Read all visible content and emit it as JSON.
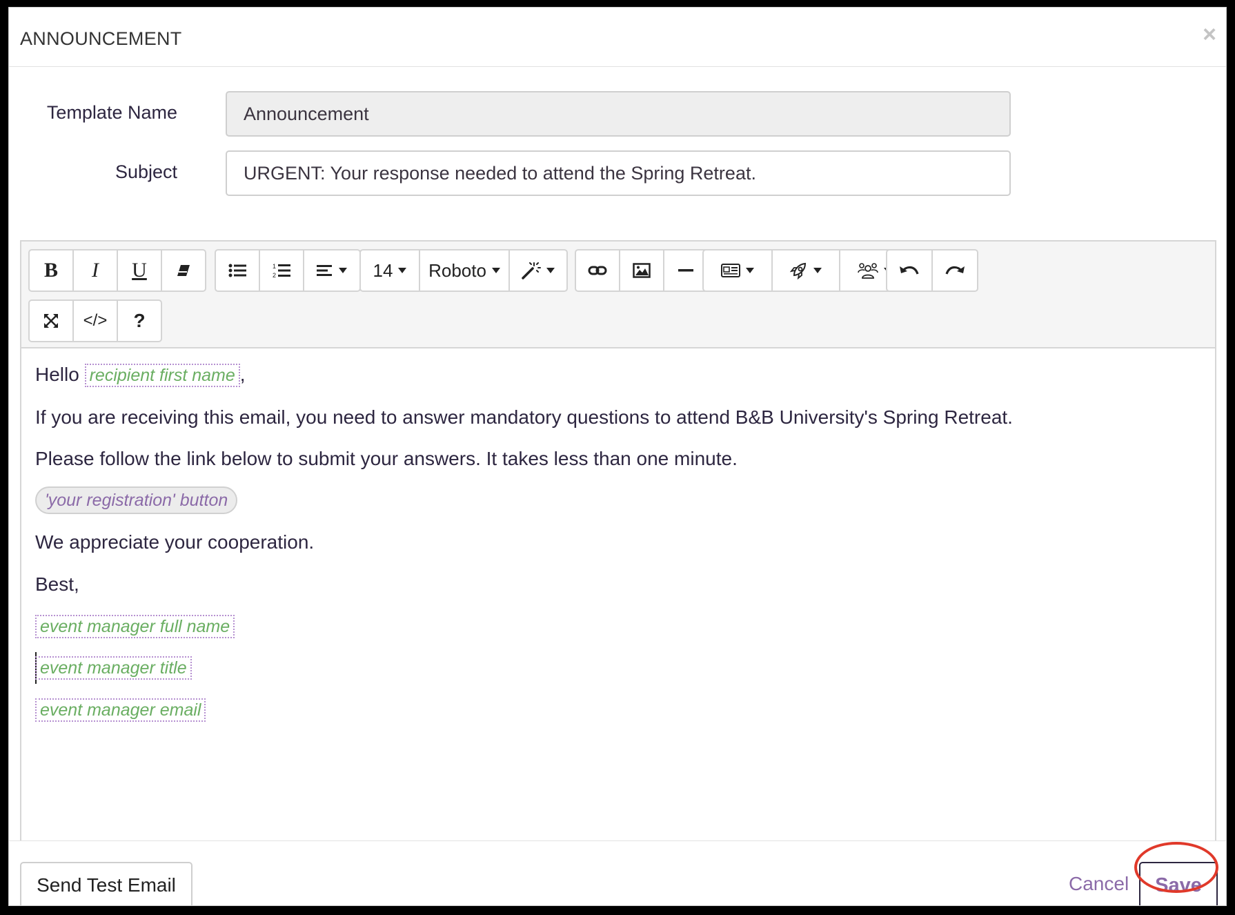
{
  "modal": {
    "title": "ANNOUNCEMENT",
    "close_symbol": "×"
  },
  "form": {
    "template_name_label": "Template Name",
    "template_name_value": "Announcement",
    "subject_label": "Subject",
    "subject_value": "URGENT: Your response needed to attend the Spring Retreat."
  },
  "toolbar": {
    "bold": "B",
    "italic": "I",
    "underline": "U",
    "font_size": "14",
    "font_family": "Roboto",
    "help": "?",
    "code": "</>",
    "icons": [
      "bold-icon",
      "italic-icon",
      "underline-icon",
      "eraser-icon",
      "unordered-list-icon",
      "ordered-list-icon",
      "align-icon",
      "magic-wand-icon",
      "link-icon",
      "image-icon",
      "horizontal-rule-icon",
      "contact-card-icon",
      "rocket-icon",
      "people-icon",
      "undo-icon",
      "redo-icon",
      "fullscreen-icon",
      "code-view-icon",
      "help-icon"
    ]
  },
  "body": {
    "greeting": "Hello",
    "recipient_token": "recipient first name",
    "comma": ",",
    "line1": "If you are receiving this email, you need to answer mandatory questions to attend B&B University's Spring Retreat.",
    "line2": "Please follow the link below to submit your answers. It takes less than one minute.",
    "registration_button": "'your registration' button",
    "line3": "We appreciate your cooperation.",
    "signoff": "Best,",
    "manager_name_token": "event manager full name",
    "manager_title_token": "event manager title",
    "manager_email_token": "event manager email"
  },
  "footer": {
    "send_test_label": "Send Test Email",
    "cancel_label": "Cancel",
    "save_label": "Save"
  },
  "colors": {
    "token_text": "#6aae62",
    "token_border": "#b58fd0",
    "link_purple": "#8b6aa8",
    "highlight_red": "#e0392a"
  }
}
